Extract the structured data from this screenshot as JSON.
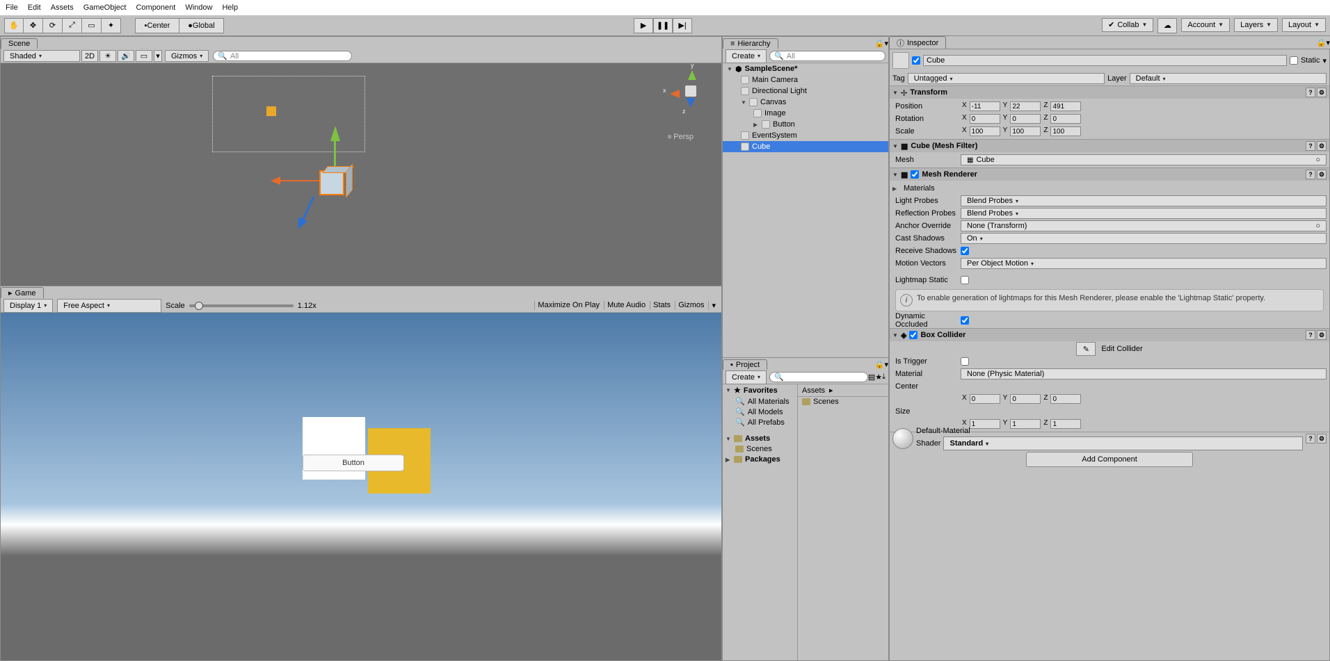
{
  "menu": [
    "File",
    "Edit",
    "Assets",
    "GameObject",
    "Component",
    "Window",
    "Help"
  ],
  "toolbar": {
    "center": "Center",
    "global": "Global",
    "collab": "Collab",
    "account": "Account",
    "layers": "Layers",
    "layout": "Layout"
  },
  "tabs": {
    "scene": "Scene",
    "game": "Game",
    "hierarchy": "Hierarchy",
    "project": "Project",
    "inspector": "Inspector"
  },
  "scene": {
    "shading": "Shaded",
    "twoD": "2D",
    "gizmos": "Gizmos",
    "searchPH": "All",
    "persp": "Persp",
    "axes": {
      "x": "x",
      "y": "y",
      "z": "z"
    }
  },
  "game": {
    "display": "Display 1",
    "aspect": "Free Aspect",
    "scaleLbl": "Scale",
    "scaleVal": "1.12x",
    "maxOnPlay": "Maximize On Play",
    "muteAudio": "Mute Audio",
    "stats": "Stats",
    "gizmos": "Gizmos",
    "buttonLabel": "Button"
  },
  "hierarchy": {
    "create": "Create",
    "searchPH": "All",
    "scene": "SampleScene*",
    "items": [
      {
        "name": "Main Camera",
        "indent": 1
      },
      {
        "name": "Directional Light",
        "indent": 1
      },
      {
        "name": "Canvas",
        "indent": 1,
        "expand": true
      },
      {
        "name": "Image",
        "indent": 2
      },
      {
        "name": "Button",
        "indent": 2,
        "hasChild": true
      },
      {
        "name": "EventSystem",
        "indent": 1
      },
      {
        "name": "Cube",
        "indent": 1,
        "sel": true
      }
    ]
  },
  "project": {
    "create": "Create",
    "searchPH": "",
    "favorites": "Favorites",
    "favItems": [
      "All Materials",
      "All Models",
      "All Prefabs"
    ],
    "assets": "Assets",
    "scenes": "Scenes",
    "packages": "Packages",
    "breadcrumb": "Assets",
    "rightItem": "Scenes"
  },
  "inspector": {
    "name": "Cube",
    "static": "Static",
    "tag": "Tag",
    "tagVal": "Untagged",
    "layer": "Layer",
    "layerVal": "Default",
    "transform": {
      "title": "Transform",
      "position": "Position",
      "pos": {
        "x": "-11",
        "y": "22",
        "z": "491"
      },
      "rotation": "Rotation",
      "rot": {
        "x": "0",
        "y": "0",
        "z": "0"
      },
      "scale": "Scale",
      "scl": {
        "x": "100",
        "y": "100",
        "z": "100"
      }
    },
    "meshFilter": {
      "title": "Cube (Mesh Filter)",
      "mesh": "Mesh",
      "meshVal": "Cube"
    },
    "meshRenderer": {
      "title": "Mesh Renderer",
      "materials": "Materials",
      "lightProbes": "Light Probes",
      "lightProbesVal": "Blend Probes",
      "reflProbes": "Reflection Probes",
      "reflProbesVal": "Blend Probes",
      "anchor": "Anchor Override",
      "anchorVal": "None (Transform)",
      "castShadows": "Cast Shadows",
      "castShadowsVal": "On",
      "recvShadows": "Receive Shadows",
      "motion": "Motion Vectors",
      "motionVal": "Per Object Motion",
      "lightmap": "Lightmap Static",
      "info": "To enable generation of lightmaps for this Mesh Renderer, please enable the 'Lightmap Static' property.",
      "dynOcc": "Dynamic Occluded"
    },
    "boxCollider": {
      "title": "Box Collider",
      "edit": "Edit Collider",
      "isTrigger": "Is Trigger",
      "material": "Material",
      "materialVal": "None (Physic Material)",
      "center": "Center",
      "cen": {
        "x": "0",
        "y": "0",
        "z": "0"
      },
      "size": "Size",
      "siz": {
        "x": "1",
        "y": "1",
        "z": "1"
      }
    },
    "defaultMat": {
      "title": "Default-Material",
      "shader": "Shader",
      "shaderVal": "Standard"
    },
    "addComponent": "Add Component"
  }
}
